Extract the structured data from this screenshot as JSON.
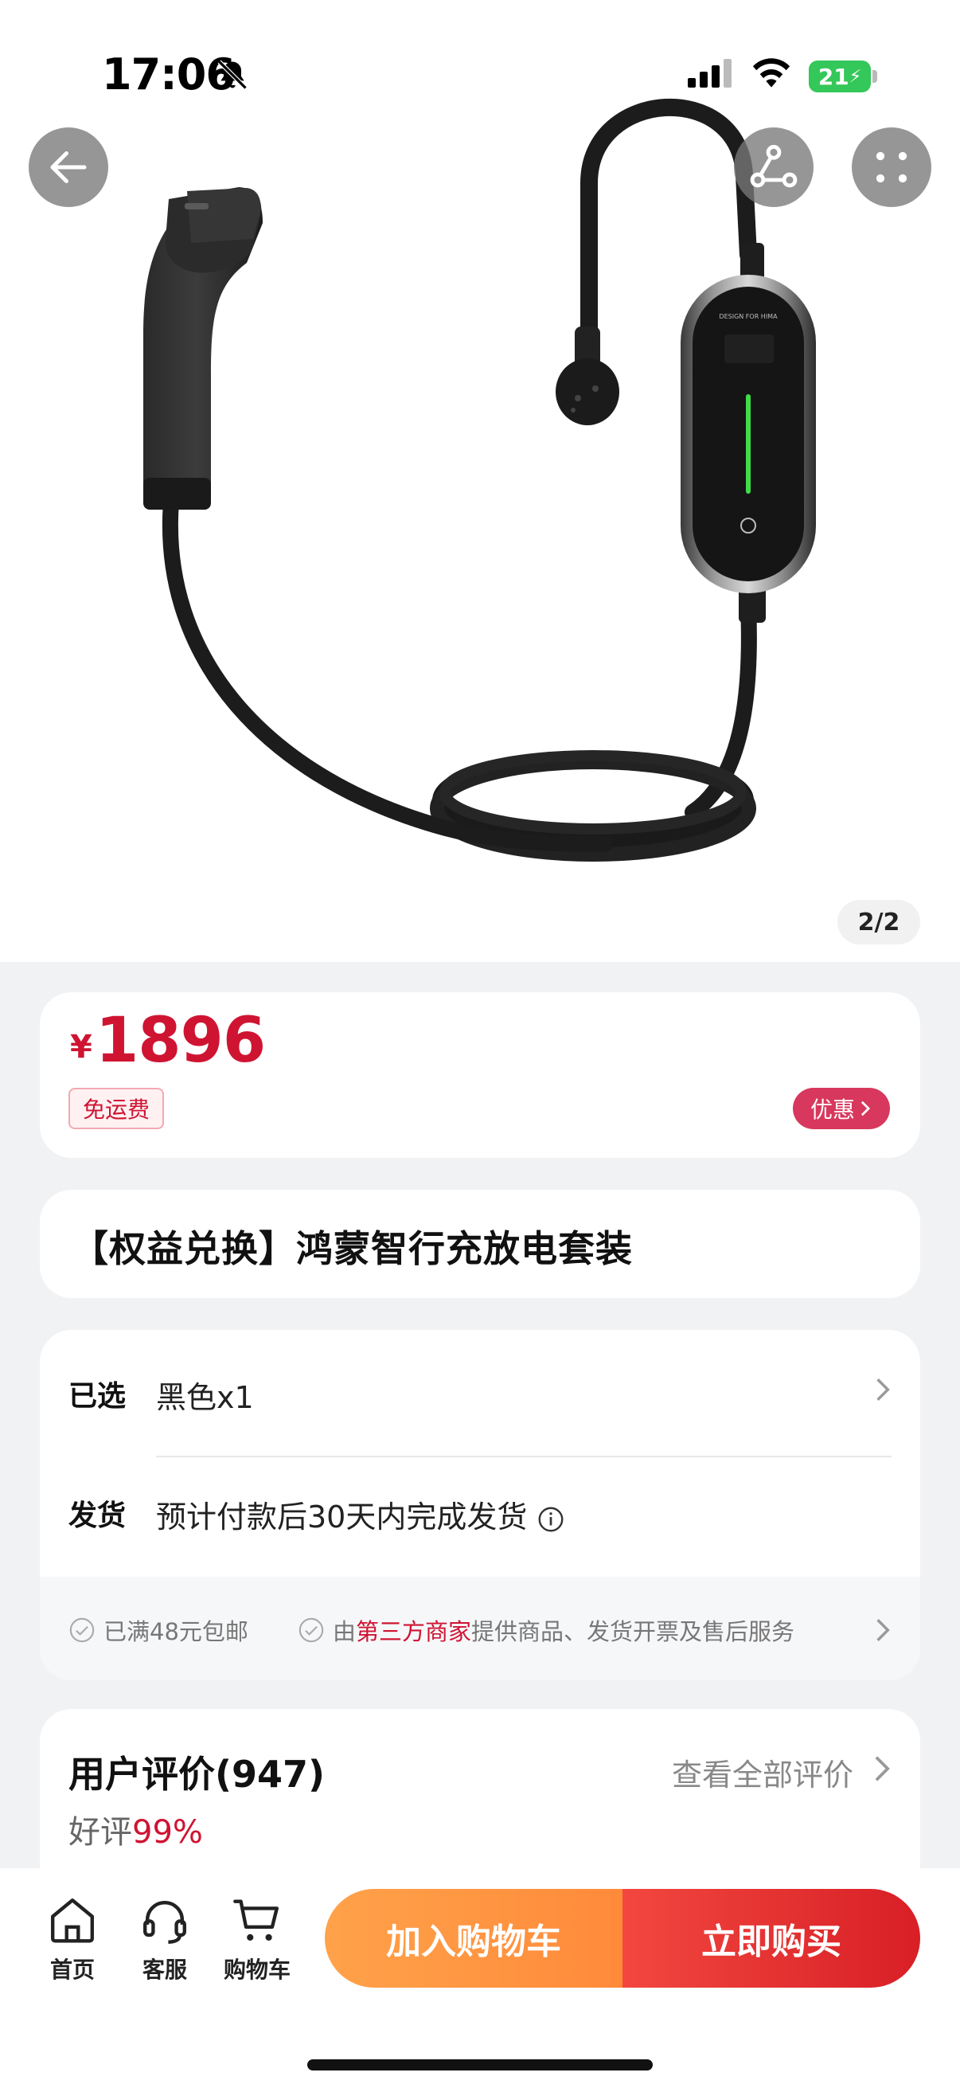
{
  "status_bar": {
    "time": "17:06",
    "battery": "21"
  },
  "gallery": {
    "page_indicator": "2/2",
    "image_icon": "ev-charger-image",
    "device_text": "DESIGN FOR HIMA"
  },
  "price": {
    "currency": "¥",
    "amount": "1896",
    "free_shipping": "免运费",
    "discount_label": "优惠",
    "accent_color": "#cf1432"
  },
  "product": {
    "title": "【权益兑换】鸿蒙智行充放电套装"
  },
  "options": {
    "selected_label": "已选",
    "selected_value": "黑色x1",
    "shipping_label": "发货",
    "shipping_value": "预计付款后30天内完成发货"
  },
  "services": {
    "item1": "已满48元包邮",
    "item2_prefix": "由",
    "item2_highlight": "第三方商家",
    "item2_suffix": "提供商品、发货开票及售后服务"
  },
  "reviews": {
    "title": "用户评价(947)",
    "view_all": "查看全部评价",
    "rate_label": "好评",
    "rate_value": "99%"
  },
  "bottom_nav": {
    "home": "首页",
    "service": "客服",
    "cart": "购物车",
    "add_to_cart": "加入购物车",
    "buy_now": "立即购买"
  }
}
